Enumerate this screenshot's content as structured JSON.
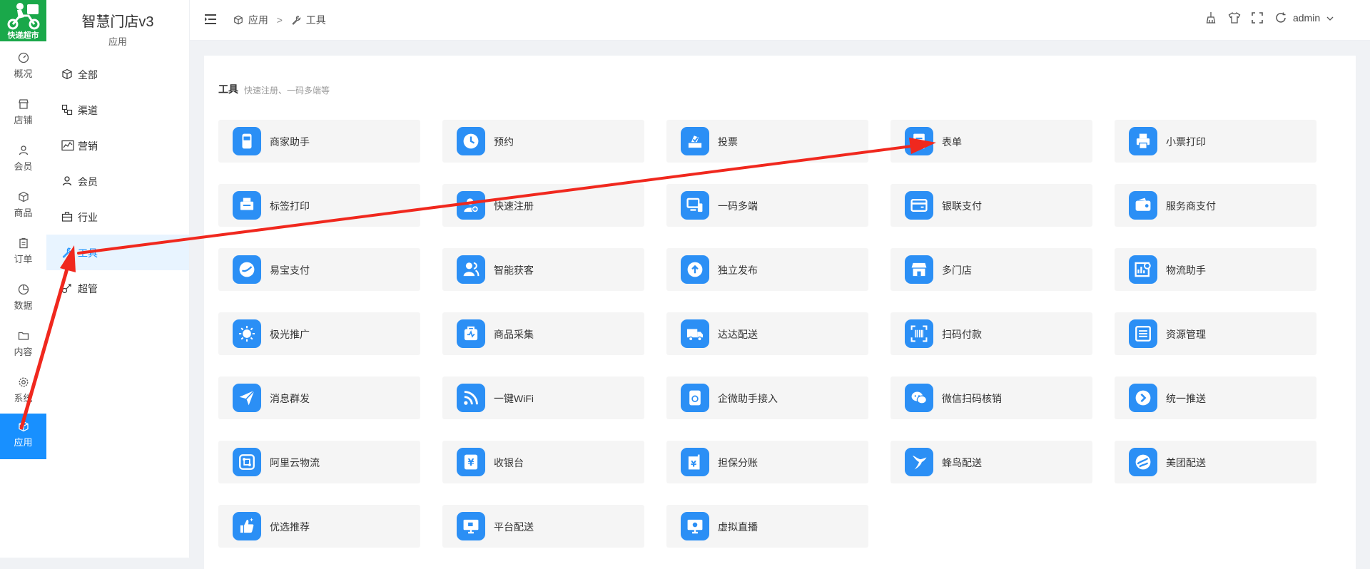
{
  "logo": {
    "text": "快递超市"
  },
  "rail": [
    {
      "label": "概况",
      "icon": "dashboard-icon"
    },
    {
      "label": "店铺",
      "icon": "store-icon"
    },
    {
      "label": "会员",
      "icon": "user-icon"
    },
    {
      "label": "商品",
      "icon": "box-icon"
    },
    {
      "label": "订单",
      "icon": "clipboard-icon"
    },
    {
      "label": "数据",
      "icon": "pie-icon"
    },
    {
      "label": "内容",
      "icon": "folder-icon"
    },
    {
      "label": "系统",
      "icon": "gear-icon"
    },
    {
      "label": "应用",
      "icon": "app-icon",
      "active": true
    }
  ],
  "subnav": {
    "title": "智慧门店v3",
    "subtitle": "应用",
    "items": [
      {
        "label": "全部",
        "icon": "cube-icon"
      },
      {
        "label": "渠道",
        "icon": "channel-icon"
      },
      {
        "label": "营销",
        "icon": "chart-icon"
      },
      {
        "label": "会员",
        "icon": "user-icon"
      },
      {
        "label": "行业",
        "icon": "briefcase-icon"
      },
      {
        "label": "工具",
        "icon": "wrench-icon",
        "active": true
      },
      {
        "label": "超管",
        "icon": "link-icon"
      }
    ]
  },
  "header": {
    "breadcrumb": [
      "应用",
      "工具"
    ],
    "separator": ">",
    "user": "admin"
  },
  "section": {
    "title": "工具",
    "subtitle": "快速注册、一码多端等"
  },
  "tools": [
    "商家助手",
    "预约",
    "投票",
    "表单",
    "小票打印",
    "标签打印",
    "快速注册",
    "一码多端",
    "银联支付",
    "服务商支付",
    "易宝支付",
    "智能获客",
    "独立发布",
    "多门店",
    "物流助手",
    "极光推广",
    "商品采集",
    "达达配送",
    "扫码付款",
    "资源管理",
    "消息群发",
    "一键WiFi",
    "企微助手接入",
    "微信扫码核销",
    "统一推送",
    "阿里云物流",
    "收银台",
    "担保分账",
    "蜂鸟配送",
    "美团配送",
    "优选推荐",
    "平台配送",
    "虚拟直播"
  ],
  "colors": {
    "accent": "#1890ff",
    "tool_icon": "#2b8ff5",
    "logo_bg": "#1aa84a",
    "arrow": "#f0281e"
  }
}
